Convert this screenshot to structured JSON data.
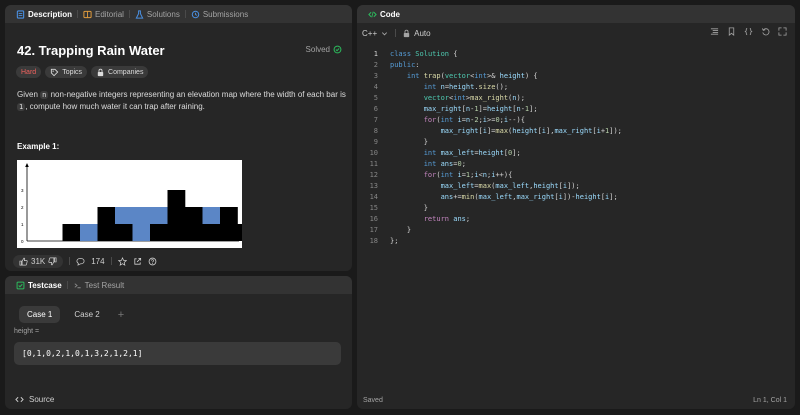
{
  "description_panel": {
    "tabs": [
      {
        "label": "Description",
        "icon": "description-icon",
        "active": true
      },
      {
        "label": "Editorial",
        "icon": "editorial-icon",
        "active": false
      },
      {
        "label": "Solutions",
        "icon": "flask-icon",
        "active": false
      },
      {
        "label": "Submissions",
        "icon": "history-icon",
        "active": false
      }
    ],
    "problem_title": "42. Trapping Rain Water",
    "solved_label": "Solved",
    "tags": {
      "difficulty": "Hard",
      "topics": "Topics",
      "companies": "Companies"
    },
    "description": {
      "part1": "Given ",
      "code1": "n",
      "part2": " non-negative integers representing an elevation map where the width of each bar is ",
      "code2": "1",
      "part3": ", compute how much water it can trap after raining."
    },
    "example_heading": "Example 1:",
    "figure": {
      "heights": [
        0,
        1,
        0,
        2,
        1,
        0,
        1,
        3,
        2,
        1,
        2,
        1
      ],
      "water": [
        0,
        0,
        1,
        0,
        1,
        2,
        1,
        0,
        0,
        1,
        0,
        0
      ],
      "y_ticks": [
        "0",
        "1",
        "2",
        "3"
      ],
      "bar_color": "#000000",
      "water_color": "#5b86c6"
    },
    "footer": {
      "likes": "31K",
      "comments": "174"
    }
  },
  "testcase_panel": {
    "tabs": [
      {
        "label": "Testcase",
        "icon": "checkbox-icon",
        "active": true
      },
      {
        "label": "Test Result",
        "icon": "terminal-icon",
        "active": false
      }
    ],
    "cases": [
      "Case 1",
      "Case 2"
    ],
    "input_label": "height =",
    "input_value": "[0,1,0,2,1,0,1,3,2,1,2,1]",
    "source_label": "Source"
  },
  "code_panel": {
    "tab_label": "Code",
    "language": "C++",
    "autocomplete": "Auto",
    "status_left": "Saved",
    "status_right": "Ln 1, Col 1",
    "line_numbers": [
      "1",
      "2",
      "3",
      "4",
      "5",
      "6",
      "7",
      "8",
      "9",
      "10",
      "11",
      "12",
      "13",
      "14",
      "15",
      "16",
      "17",
      "18"
    ]
  },
  "colors": {
    "accent_green": "#2cbb5d",
    "hard": "#f0625e",
    "bg": "#1a1a1a",
    "panel": "#262626"
  }
}
